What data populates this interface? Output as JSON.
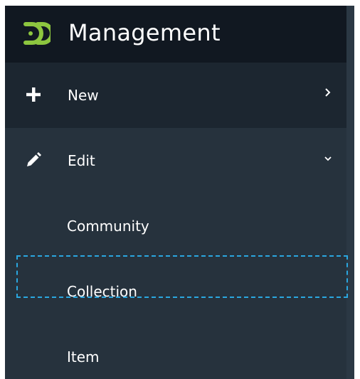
{
  "header": {
    "title": "Management",
    "logo_icon": "dspace-logo-icon",
    "logo_color": "#8dc63f"
  },
  "menu": {
    "new": {
      "label": "New",
      "icon": "plus-icon",
      "chevron": "chevron-right-icon",
      "expanded": false
    },
    "edit": {
      "label": "Edit",
      "icon": "pencil-icon",
      "chevron": "chevron-down-icon",
      "expanded": true,
      "items": [
        {
          "label": "Community",
          "focused": false
        },
        {
          "label": "Collection",
          "focused": true
        },
        {
          "label": "Item",
          "focused": false
        }
      ]
    }
  },
  "colors": {
    "sidebar_bg": "#26323d",
    "header_bg": "#111821",
    "active_row_bg": "#1c2630",
    "focus_outline": "#2aa7e0",
    "text": "#ffffff"
  }
}
